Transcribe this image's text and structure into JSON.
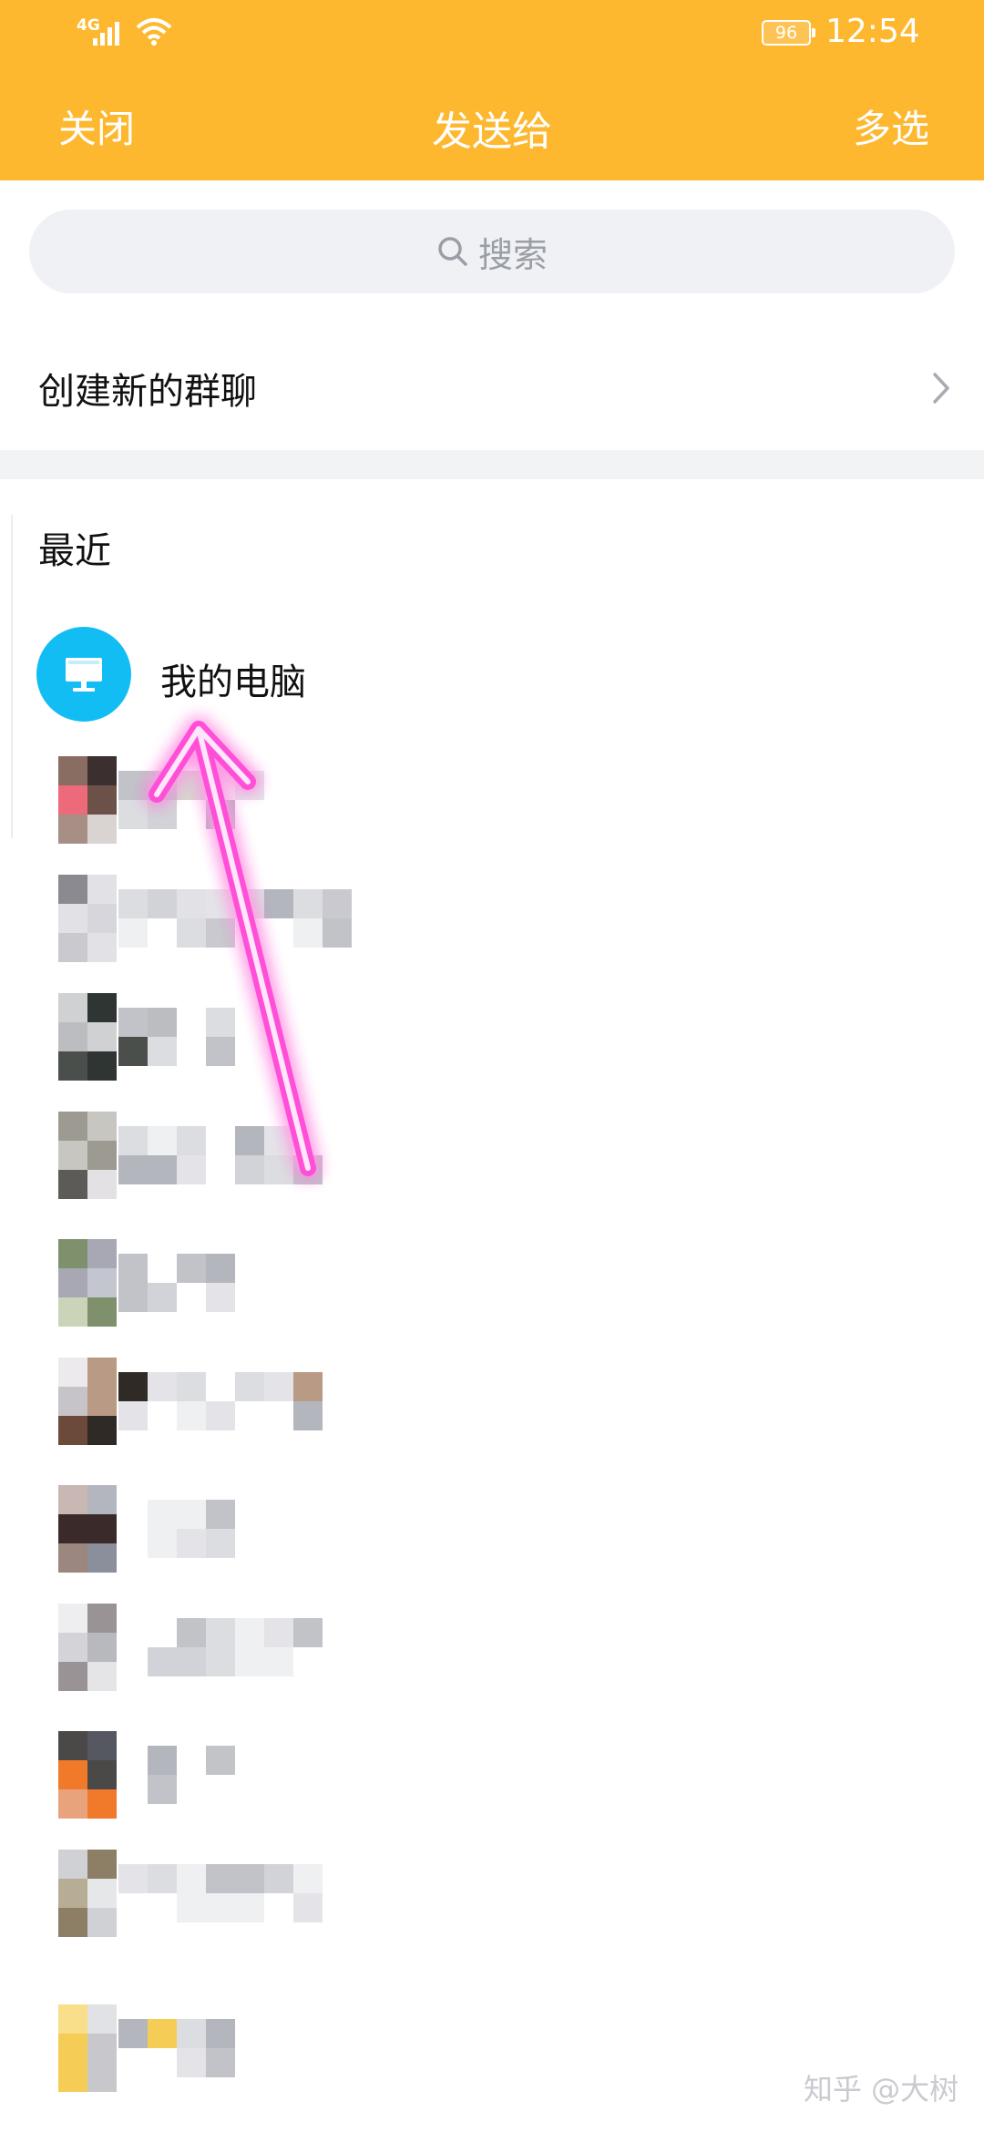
{
  "status_bar": {
    "network": "4G",
    "battery": "96",
    "time": "12:54"
  },
  "nav": {
    "close": "关闭",
    "title": "发送给",
    "multi_select": "多选"
  },
  "search": {
    "placeholder": "搜索"
  },
  "create_group": {
    "label": "创建新的群聊"
  },
  "recent": {
    "title": "最近",
    "first_contact": "我的电脑"
  },
  "colors": {
    "header": "#FDB830",
    "pc_avatar": "#12BDF3",
    "annotation_arrow": "#FF4FD8"
  },
  "icons": {
    "search": "search-icon",
    "chevron": "chevron-right-icon",
    "pc": "monitor-icon"
  },
  "watermark": "知乎 @大树"
}
